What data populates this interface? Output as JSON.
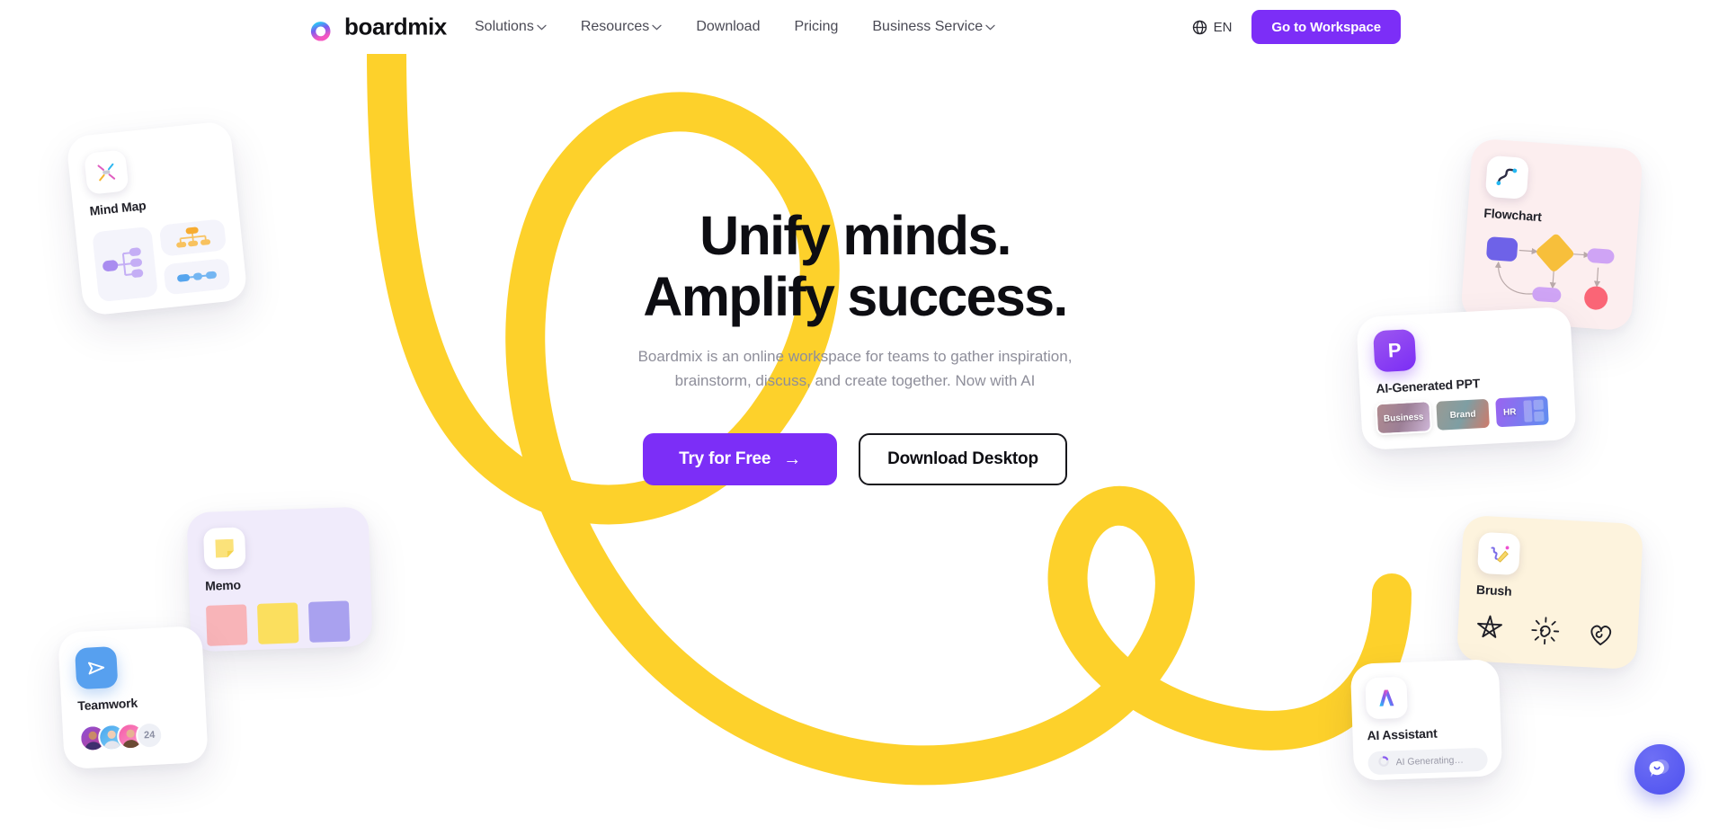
{
  "brand": {
    "name": "boardmix",
    "logo_icon": "boardmix-b-logo"
  },
  "nav": {
    "items": [
      {
        "label": "Solutions",
        "has_dropdown": true
      },
      {
        "label": "Resources",
        "has_dropdown": true
      },
      {
        "label": "Download",
        "has_dropdown": false
      },
      {
        "label": "Pricing",
        "has_dropdown": false
      },
      {
        "label": "Business Service",
        "has_dropdown": true
      }
    ]
  },
  "header_right": {
    "language": "EN",
    "language_icon": "globe-icon",
    "workspace_button": "Go to Workspace"
  },
  "hero": {
    "headline_line1": "Unify minds.",
    "headline_line2": "Amplify success.",
    "subtitle_line1": "Boardmix is an online workspace for teams to gather inspiration,",
    "subtitle_line2": "brainstorm, discuss, and create together. Now with AI",
    "primary_cta": "Try for Free",
    "primary_cta_arrow": "→",
    "secondary_cta": "Download Desktop"
  },
  "cards": {
    "mindmap": {
      "label": "Mind Map",
      "icon": "mind-map-icon"
    },
    "memo": {
      "label": "Memo",
      "icon": "sticky-note-icon",
      "note_colors": [
        "#f8b4b8",
        "#fbdf5e",
        "#a9a1ef"
      ]
    },
    "teamwork": {
      "label": "Teamwork",
      "icon": "paper-plane-icon",
      "member_count": "24"
    },
    "flowchart": {
      "label": "Flowchart",
      "icon": "flowchart-curve-icon"
    },
    "ppt": {
      "label": "AI-Generated PPT",
      "icon": "ppt-p-icon",
      "thumbs": [
        "Business",
        "Brand",
        "HR"
      ]
    },
    "brush": {
      "label": "Brush",
      "icon": "brush-pencil-icon",
      "doodles": [
        "star-doodle",
        "sun-doodle",
        "heart-doodle"
      ]
    },
    "ai": {
      "label": "AI Assistant",
      "icon": "ai-sparkle-icon",
      "status": "AI Generating…",
      "status_icon": "loading-spinner-icon"
    }
  },
  "chat": {
    "icon": "chat-smiley-icon"
  },
  "colors": {
    "accent_purple": "#7c2ef7",
    "swoosh_yellow": "#fdd12b",
    "chat_blue": "#4e51ef",
    "text_dark": "#0d0d12",
    "text_muted": "#8e8e9a"
  }
}
